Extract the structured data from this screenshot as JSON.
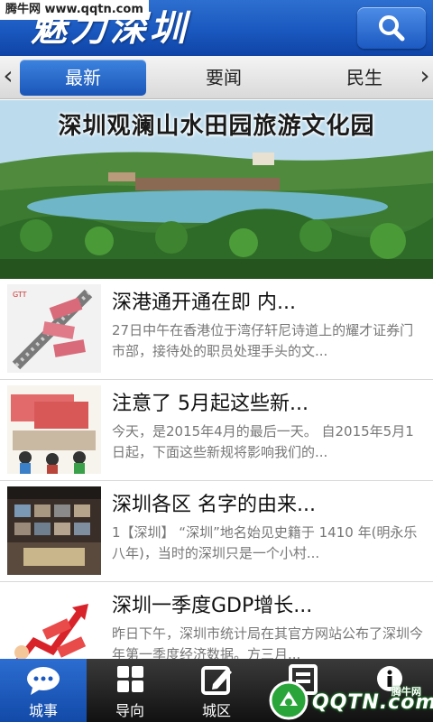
{
  "watermark_top": "腾牛网 www.qqtn.com",
  "header": {
    "title": "魅力深圳"
  },
  "tabs": [
    {
      "label": "最新",
      "active": true
    },
    {
      "label": "要闻",
      "active": false
    },
    {
      "label": "民生",
      "active": false
    }
  ],
  "banner": {
    "title": "深圳观澜山水田园旅游文化园"
  },
  "news": [
    {
      "title": "深港通开通在即 内...",
      "summary": "27日中午在香港位于湾仔轩尼诗道上的耀才证券门市部，接待处的职员处理手头的文..."
    },
    {
      "title": "注意了 5月起这些新...",
      "summary": "今天，是2015年4月的最后一天。 自2015年5月1日起，下面这些新规将影响我们的..."
    },
    {
      "title": "深圳各区 名字的由来...",
      "summary": "1【深圳】 “深圳”地名始见史籍于 1410 年(明永乐八年)，当时的深圳只是一个小村..."
    },
    {
      "title": "深圳一季度GDP增长...",
      "summary": "昨日下午，深圳市统计局在其官方网站公布了深圳今年第一季度经济数据。方三月..."
    }
  ],
  "bottom_nav": [
    {
      "label": "城事",
      "icon": "chat-bubble-icon",
      "active": true
    },
    {
      "label": "导向",
      "icon": "grid-icon",
      "active": false
    },
    {
      "label": "城区",
      "icon": "edit-icon",
      "active": false
    },
    {
      "label": "",
      "icon": "document-icon",
      "active": false
    },
    {
      "label": "",
      "icon": "info-icon",
      "active": false
    }
  ],
  "watermark_bottom": {
    "text": "QQTN.com",
    "sub": "腾牛网"
  },
  "colors": {
    "primary": "#1a58bf",
    "nav_bg": "#111111",
    "active_tab": "#2c6dd1"
  }
}
